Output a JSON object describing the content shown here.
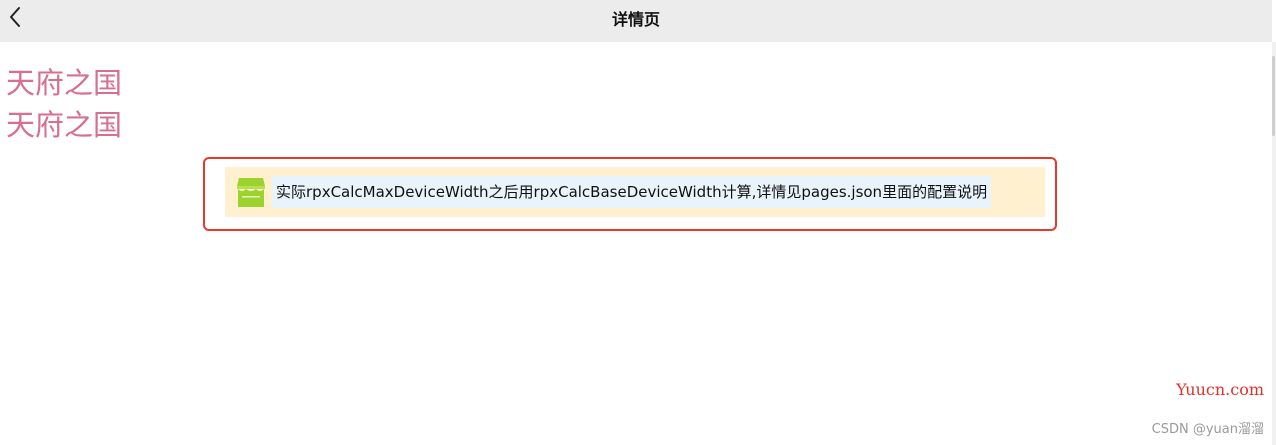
{
  "navbar": {
    "title": "详情页",
    "back_icon": "chevron-left-icon"
  },
  "content": {
    "headings": [
      "天府之国",
      "天府之国"
    ],
    "notice": {
      "icon": "store-icon",
      "text": "实际rpxCalcMaxDeviceWidth之后用rpxCalcBaseDeviceWidth计算,详情见pages.json里面的配置说明"
    }
  },
  "watermarks": {
    "site": "Yuucn.com",
    "author": "CSDN @yuan溜溜"
  },
  "colors": {
    "navbar_bg": "#ececec",
    "heading": "#d76f8f",
    "notice_bg": "#fff0cf",
    "notice_text_bg": "#e9f3fc",
    "highlight_border": "#e53a2a",
    "icon_green": "#9bd22d"
  }
}
